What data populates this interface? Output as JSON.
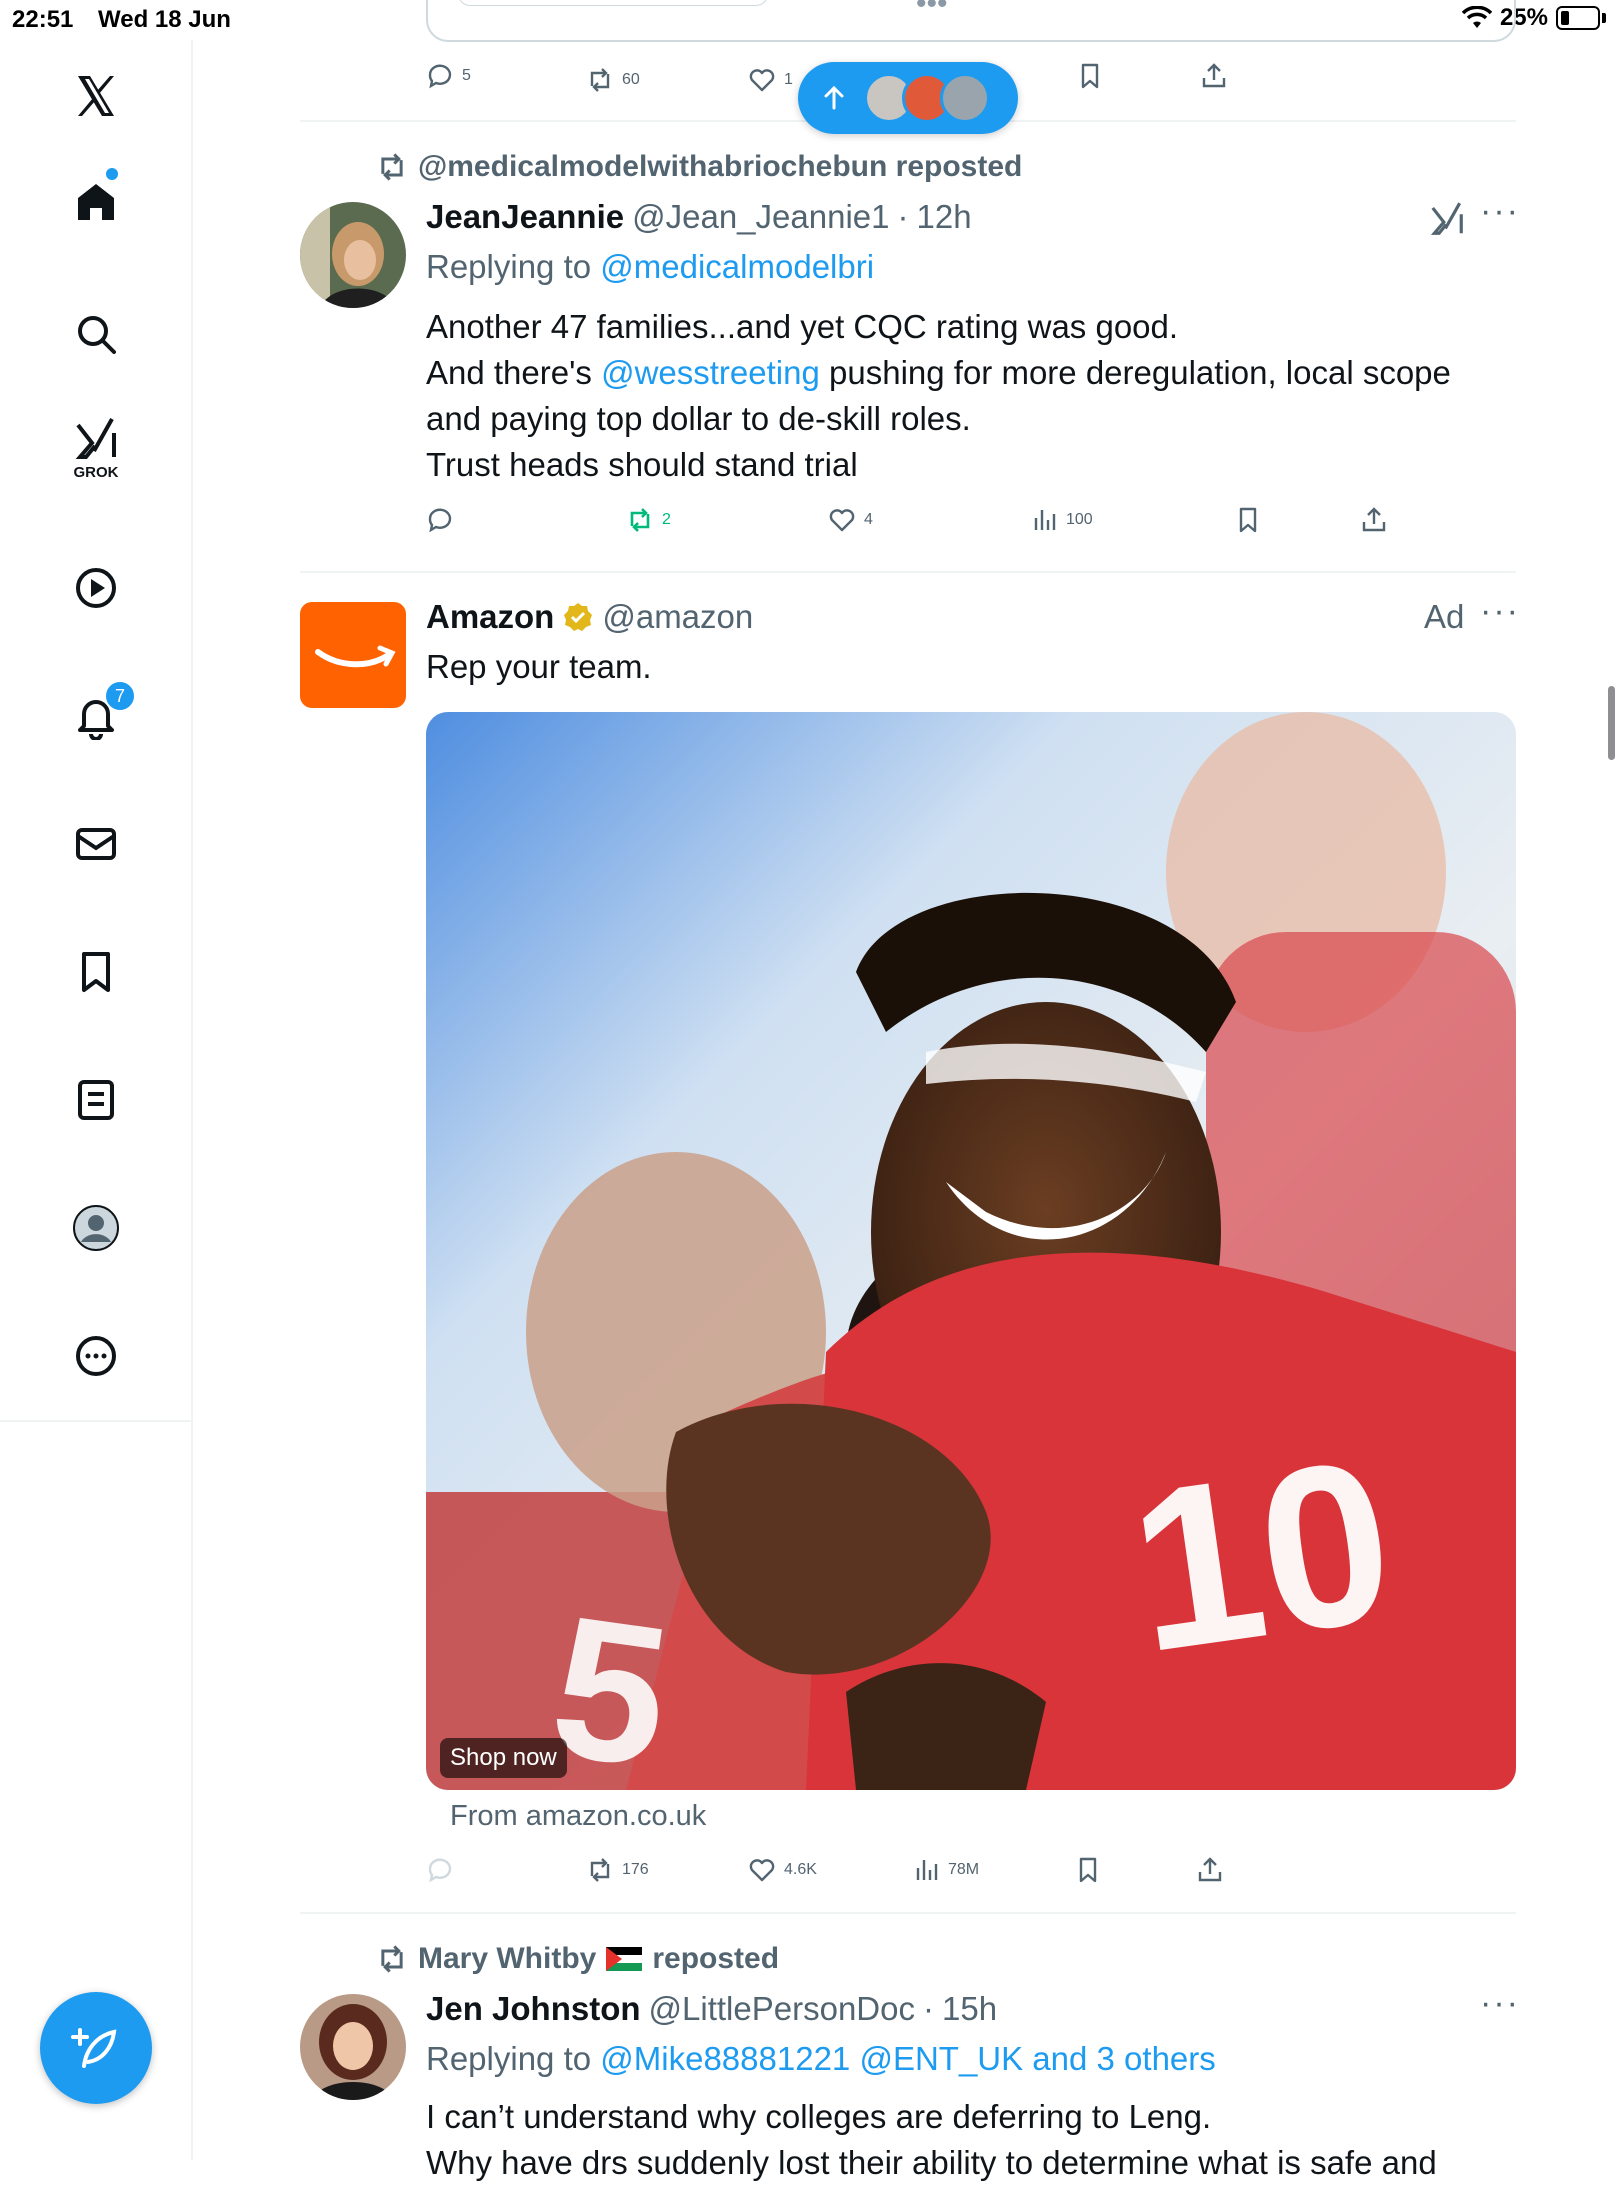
{
  "status_bar": {
    "time": "22:51",
    "date": "Wed 18 Jun",
    "battery": "25%"
  },
  "sidebar": {
    "grok_label": "GROK",
    "notifications_count": "7"
  },
  "top_post": {
    "replies": "5",
    "reposts": "60",
    "likes": "1"
  },
  "post1": {
    "reposted_by": "@medicalmodelwithabriochebun reposted",
    "name": "JeanJeannie",
    "handle": "@Jean_Jeannie1",
    "time": "12h",
    "replying_prefix": "Replying to",
    "replying_to": "@medicalmodelbri",
    "line1": "Another 47 families...and yet CQC rating was good.",
    "line2_pre": "And there's",
    "line2_mention": "@wesstreeting",
    "line2_post": "pushing for more deregulation, local scope",
    "line3": "and paying top dollar to de-skill roles.",
    "line4": "Trust heads should stand trial",
    "reposts": "2",
    "likes": "4",
    "views": "100"
  },
  "ad": {
    "name": "Amazon",
    "handle": "@amazon",
    "ad_label": "Ad",
    "text": "Rep your team.",
    "cta": "Shop now",
    "source": "From amazon.co.uk",
    "reposts": "176",
    "likes": "4.6K",
    "views": "78M"
  },
  "post2": {
    "reposted_by": "Mary Whitby",
    "reposted_suffix": "reposted",
    "name": "Jen Johnston",
    "handle": "@LittlePersonDoc",
    "time": "15h",
    "replying_prefix": "Replying to",
    "replying_to": "@Mike88881221 @ENT_UK and 3 others",
    "line1": "I can’t understand why colleges are deferring to Leng.",
    "line2": "Why have drs suddenly lost their ability to determine what is safe and"
  },
  "colors": {
    "accent": "#1d9bf0",
    "text": "#0f1419",
    "muted": "#536471",
    "repost_green": "#00ba7c",
    "amazon_orange": "#ff6200"
  }
}
